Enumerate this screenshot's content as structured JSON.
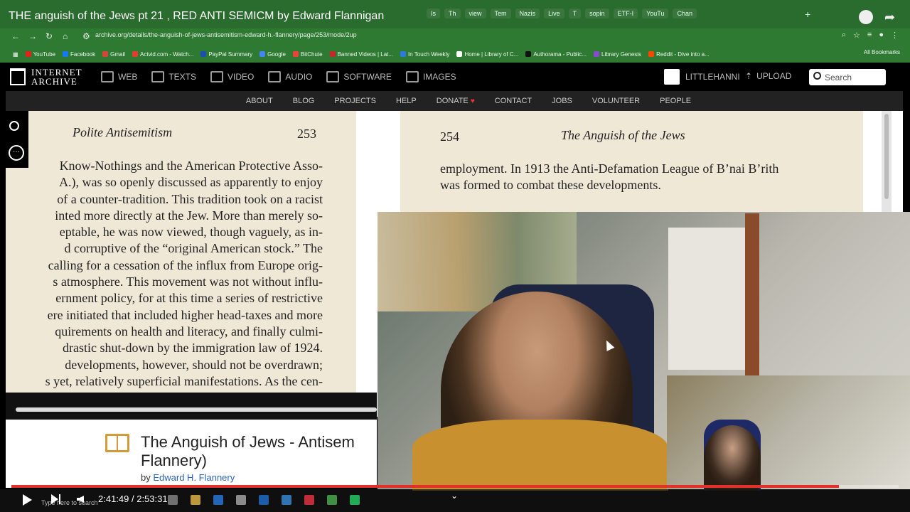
{
  "browser": {
    "tab_title": "THE anguish of the Jews pt 21 , RED ANTI SEMICM by Edward Flannigan",
    "tabs": [
      "Is",
      "Th",
      "view",
      "Tem",
      "Nazis",
      "Live",
      "T",
      "sopin",
      "ETF-I",
      "YouTu",
      "Chan"
    ],
    "new_tab": "+",
    "window_controls": [
      "—",
      "□",
      "✕"
    ],
    "url": "archive.org/details/the-anguish-of-jews-antisemitism-edward-h.-flannery/page/253/mode/2up",
    "bookmarks": [
      {
        "label": "YouTube",
        "color": "#e62117"
      },
      {
        "label": "Facebook",
        "color": "#1877f2"
      },
      {
        "label": "Gmail",
        "color": "#d44638"
      },
      {
        "label": "Actvid.com - Watch...",
        "color": "#e23c2c"
      },
      {
        "label": "PayPal Summary",
        "color": "#1c4eb3"
      },
      {
        "label": "Google",
        "color": "#4285f4"
      },
      {
        "label": "BitChute",
        "color": "#ef4137"
      },
      {
        "label": "Banned Videos | Lat...",
        "color": "#c9262b"
      },
      {
        "label": "In Touch Weekly",
        "color": "#2a7ae2"
      },
      {
        "label": "Home | Library of C...",
        "color": "#ffffff"
      },
      {
        "label": "Authorama - Public...",
        "color": "#111111"
      },
      {
        "label": "Library Genesis",
        "color": "#8a4ad0"
      },
      {
        "label": "Reddit - Dive into a...",
        "color": "#ff4500"
      }
    ],
    "all_bookmarks": "All Bookmarks"
  },
  "ia": {
    "logo_line1": "INTERNET",
    "logo_line2": "ARCHIVE",
    "nav": [
      "WEB",
      "TEXTS",
      "VIDEO",
      "AUDIO",
      "SOFTWARE",
      "IMAGES"
    ],
    "user": "LITTLEHANNI",
    "upload": "UPLOAD",
    "search_placeholder": "Search",
    "subnav": [
      "ABOUT",
      "BLOG",
      "PROJECTS",
      "HELP",
      "DONATE",
      "CONTACT",
      "JOBS",
      "VOLUNTEER",
      "PEOPLE"
    ]
  },
  "left_page": {
    "header": "Polite Antisemitism",
    "number": "253",
    "lines": [
      "Know-Nothings and the American Protective Asso-",
      "A.), was so openly discussed as apparently to enjoy",
      "of a counter-tradition. This tradition took on a racist",
      "inted more directly at the Jew. More than merely so-",
      "eptable, he was now viewed, though vaguely, as in-",
      "d corruptive of the “original American stock.” The",
      "calling for a cessation of the influx from Europe orig-",
      "s atmosphere. This movement was not without influ-",
      "ernment policy, for at this time a series of restrictive",
      "ere initiated that included higher head-taxes and more",
      "quirements on health and literacy, and finally culmi-",
      "drastic shut-down by the immigration law of 1924.",
      "developments, however, should not be overdrawn;",
      "s yet, relatively superficial manifestations. As the cen-"
    ]
  },
  "right_page": {
    "number": "254",
    "header": "The Anguish of the Jews",
    "lines": [
      "employment. In 1913 the Anti-Defamation League of B’nai B’rith",
      "was formed to combat these developments."
    ]
  },
  "book": {
    "title_line1": "The Anguish of Jews - Antisem",
    "title_line2": "Flannery)",
    "by": "by",
    "author": "Edward H. Flannery"
  },
  "player": {
    "current_time": "2:41:49",
    "total_time": "2:53:31",
    "time_display": "2:41:49 / 2:53:31",
    "progress": 0.9325,
    "taskbar_search": "Type here to search"
  }
}
